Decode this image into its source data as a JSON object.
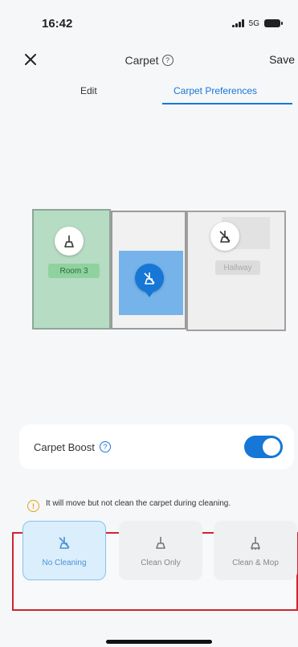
{
  "status": {
    "time": "16:42",
    "network": "5G"
  },
  "header": {
    "title": "Carpet",
    "save_label": "Save"
  },
  "tabs": [
    {
      "label": "Edit",
      "active": false
    },
    {
      "label": "Carpet Preferences",
      "active": true
    }
  ],
  "map": {
    "rooms": [
      {
        "label": "Room 3",
        "highlight": "green"
      },
      {
        "label": "Hallway",
        "highlight": "faded"
      }
    ]
  },
  "boost": {
    "label": "Carpet Boost",
    "enabled": true
  },
  "note": {
    "text": "It will move but not clean the carpet during cleaning."
  },
  "options": [
    {
      "label": "No Cleaning",
      "selected": true
    },
    {
      "label": "Clean Only",
      "selected": false
    },
    {
      "label": "Clean & Mop",
      "selected": false
    }
  ],
  "colors": {
    "accent": "#1677d6",
    "room_green": "#b6dcc3",
    "highlight_frame": "#d0242f",
    "warning": "#e2a316"
  }
}
